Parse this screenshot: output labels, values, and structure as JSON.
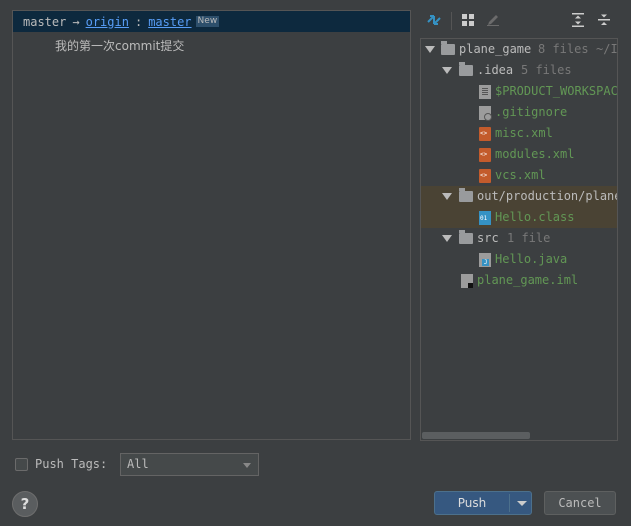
{
  "commits_panel": {
    "branch": {
      "local": "master",
      "arrow": "→",
      "remote": "origin",
      "separator": ":",
      "remote_branch": "master",
      "badge": "New"
    },
    "commits": [
      {
        "message": "我的第一次commit提交"
      }
    ]
  },
  "changes_panel": {
    "toolbar_icons": [
      "diff-icon",
      "group-by-icon",
      "edit-icon",
      "expand-all-icon",
      "collapse-all-icon"
    ],
    "tree": {
      "root": {
        "name": "plane_game",
        "meta": "8 files",
        "path": "~/I"
      },
      "idea": {
        "name": ".idea",
        "meta": "5 files"
      },
      "idea_files": [
        "$PRODUCT_WORKSPACE",
        ".gitignore",
        "misc.xml",
        "modules.xml",
        "vcs.xml"
      ],
      "out": {
        "name": "out/production/plane"
      },
      "out_files": [
        "Hello.class"
      ],
      "src": {
        "name": "src",
        "meta": "1 file"
      },
      "src_files": [
        "Hello.java"
      ],
      "root_files": [
        "plane_game.iml"
      ]
    }
  },
  "footer": {
    "push_tags_label": "Push Tags:",
    "push_tags_checked": false,
    "tags_select_value": "All",
    "help_label": "?",
    "push_label": "Push",
    "cancel_label": "Cancel"
  },
  "colors": {
    "background": "#3c3f41",
    "branch_row": "#0d293e",
    "link": "#589df6",
    "added_file": "#629755",
    "highlight_row": "#4a4334",
    "primary_button": "#365880"
  }
}
